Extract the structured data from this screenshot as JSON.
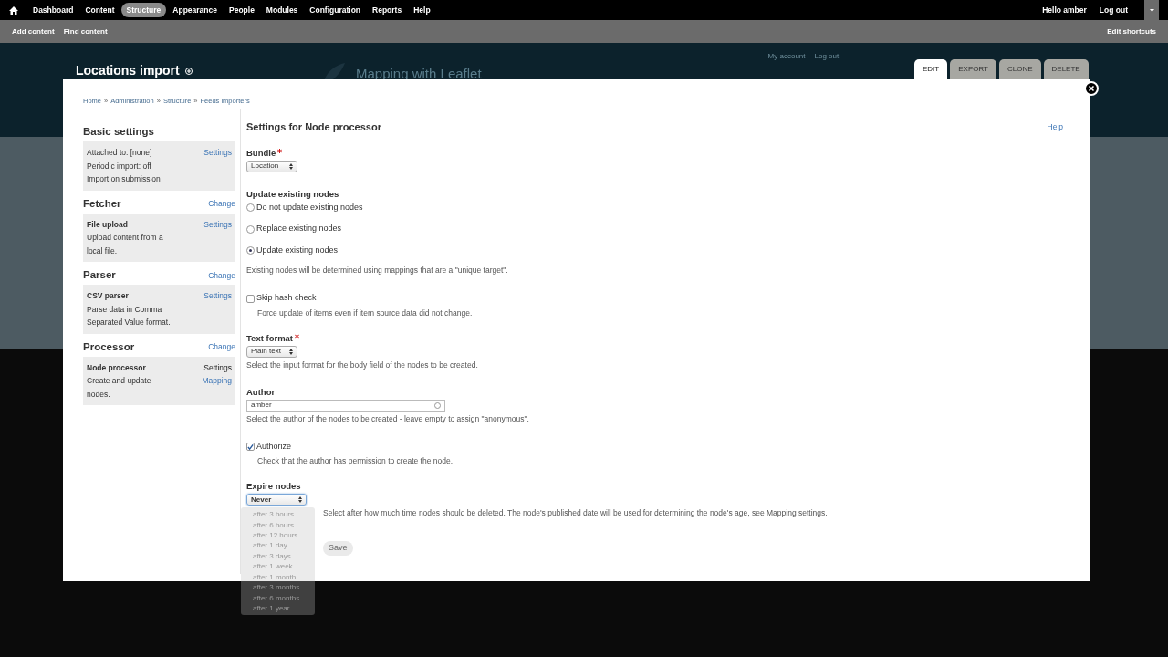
{
  "toolbar": {
    "menu": [
      {
        "label": "Dashboard",
        "selected": false
      },
      {
        "label": "Content",
        "selected": false
      },
      {
        "label": "Structure",
        "selected": true
      },
      {
        "label": "Appearance",
        "selected": false
      },
      {
        "label": "People",
        "selected": false
      },
      {
        "label": "Modules",
        "selected": false
      },
      {
        "label": "Configuration",
        "selected": false
      },
      {
        "label": "Reports",
        "selected": false
      },
      {
        "label": "Help",
        "selected": false
      }
    ],
    "user": "Hello amber",
    "logout": "Log out"
  },
  "shortcuts": {
    "items": [
      "Add content",
      "Find content"
    ],
    "edit": "Edit shortcuts"
  },
  "background": {
    "page_title": "Locations import",
    "site_name": "Mapping with Leaflet",
    "links": [
      "My account",
      "Log out"
    ]
  },
  "tabs": [
    {
      "label": "EDIT",
      "selected": true
    },
    {
      "label": "EXPORT",
      "selected": false
    },
    {
      "label": "CLONE",
      "selected": false
    },
    {
      "label": "DELETE",
      "selected": false
    }
  ],
  "breadcrumb": [
    "Home",
    "Administration",
    "Structure",
    "Feeds importers"
  ],
  "breadcrumb_separator": "»",
  "sidebar": [
    {
      "title": "Basic settings",
      "box": {
        "lines": [
          "Attached to: [none]",
          "Periodic import: off",
          "Import on submission"
        ],
        "links": [
          {
            "label": "Settings",
            "selected": false
          }
        ]
      }
    },
    {
      "title": "Fetcher",
      "action": "Change",
      "box": {
        "heading": "File upload",
        "lines": [
          "Upload content from a",
          "local file."
        ],
        "links": [
          {
            "label": "Settings",
            "selected": false
          }
        ]
      }
    },
    {
      "title": "Parser",
      "action": "Change",
      "box": {
        "heading": "CSV parser",
        "lines": [
          "Parse data in Comma",
          "Separated Value format."
        ],
        "links": [
          {
            "label": "Settings",
            "selected": false
          }
        ]
      }
    },
    {
      "title": "Processor",
      "action": "Change",
      "box": {
        "heading": "Node processor",
        "lines": [
          "Create and update",
          "nodes."
        ],
        "links": [
          {
            "label": "Settings",
            "selected": true
          },
          {
            "label": "Mapping",
            "selected": false
          }
        ]
      }
    }
  ],
  "main": {
    "title": "Settings for Node processor",
    "help": "Help",
    "fields": [
      {
        "kind": "select",
        "label": "Bundle",
        "required": true,
        "value": "Location"
      },
      {
        "kind": "radios",
        "label": "Update existing nodes",
        "options": [
          {
            "label": "Do not update existing nodes",
            "selected": false
          },
          {
            "label": "Replace existing nodes",
            "selected": false
          },
          {
            "label": "Update existing nodes",
            "selected": true
          }
        ],
        "description": "Existing nodes will be determined using mappings that are a \"unique target\"."
      },
      {
        "kind": "checkbox",
        "label": "Skip hash check",
        "checked": false,
        "description": "Force update of items even if item source data did not change."
      },
      {
        "kind": "select",
        "label": "Text format",
        "required": true,
        "value": "Plain text",
        "description": "Select the input format for the body field of the nodes to be created."
      },
      {
        "kind": "autocomplete",
        "label": "Author",
        "value": "amber",
        "description": "Select the author of the nodes to be created - leave empty to assign \"anonymous\"."
      },
      {
        "kind": "checkbox",
        "label": "Authorize",
        "checked": true,
        "description": "Check that the author has permission to create the node."
      },
      {
        "kind": "select",
        "label": "Expire nodes",
        "value": "Never",
        "open": true,
        "options": [
          "after 3 hours",
          "after 6 hours",
          "after 12 hours",
          "after 1 day",
          "after 3 days",
          "after 1 week",
          "after 1 month",
          "after 3 months",
          "after 6 months",
          "after 1 year"
        ],
        "description": "Select after how much time nodes should be deleted. The node's published date will be used for determining the node's age, see Mapping settings."
      }
    ],
    "save": "Save"
  }
}
